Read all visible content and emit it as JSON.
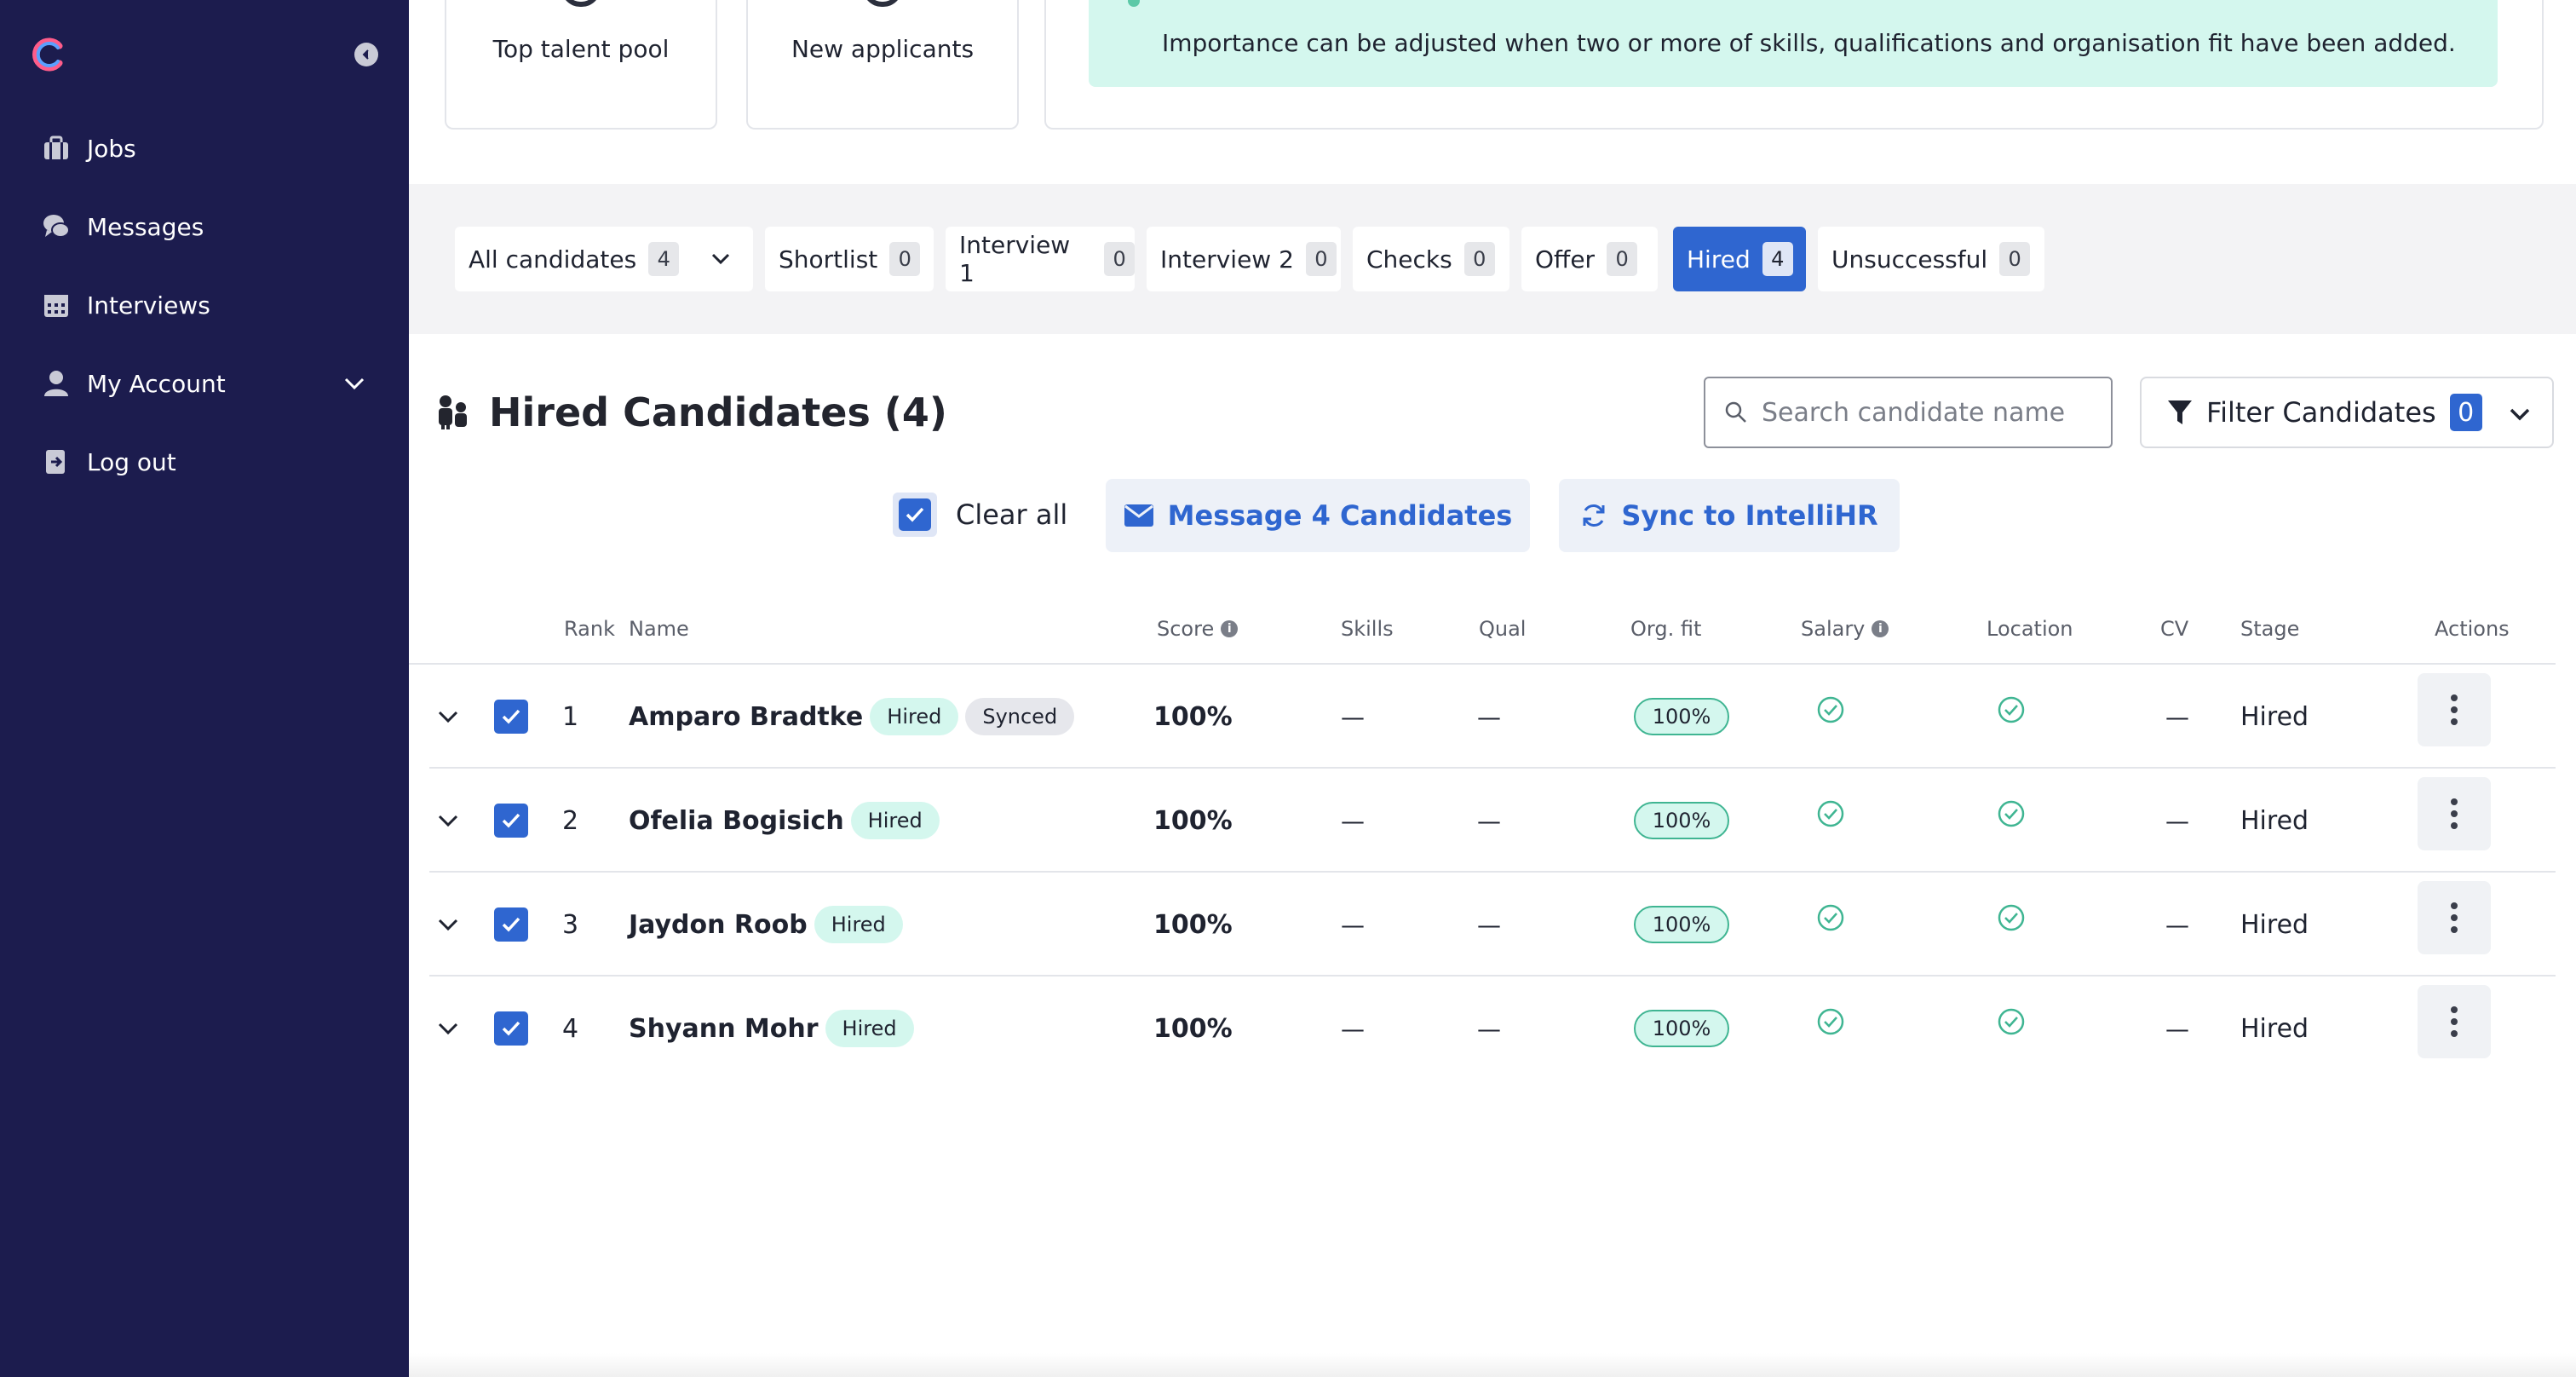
{
  "sidebar": {
    "items": [
      {
        "label": "Jobs",
        "icon": "briefcase-icon"
      },
      {
        "label": "Messages",
        "icon": "chat-bubbles-icon"
      },
      {
        "label": "Interviews",
        "icon": "calendar-icon"
      },
      {
        "label": "My Account",
        "icon": "user-icon"
      },
      {
        "label": "Log out",
        "icon": "logout-icon"
      }
    ]
  },
  "stats": {
    "top_talent": "Top talent pool",
    "new_applicants": "New applicants"
  },
  "info_banner": {
    "text": "Importance can be adjusted when two or more of skills, qualifications and organisation fit have been added."
  },
  "tabs": [
    {
      "label": "All candidates",
      "count": "4"
    },
    {
      "label": "Shortlist",
      "count": "0"
    },
    {
      "label": "Interview 1",
      "count": "0"
    },
    {
      "label": "Interview 2",
      "count": "0"
    },
    {
      "label": "Checks",
      "count": "0"
    },
    {
      "label": "Offer",
      "count": "0"
    },
    {
      "label": "Hired",
      "count": "4"
    },
    {
      "label": "Unsuccessful",
      "count": "0"
    }
  ],
  "section": {
    "title": "Hired Candidates (4)",
    "search_placeholder": "Search candidate name",
    "filter_label": "Filter Candidates",
    "filter_count": "0",
    "clear_all": "Clear all",
    "message_btn": "Message 4 Candidates",
    "sync_btn": "Sync to IntelliHR"
  },
  "table": {
    "headers": {
      "rank": "Rank",
      "name": "Name",
      "score": "Score",
      "skills": "Skills",
      "qual": "Qual",
      "orgfit": "Org. fit",
      "salary": "Salary",
      "location": "Location",
      "cv": "CV",
      "stage": "Stage",
      "actions": "Actions"
    },
    "rows": [
      {
        "rank": "1",
        "name": "Amparo Bradtke",
        "badge1": "Hired",
        "badge2": "Synced",
        "score": "100%",
        "skills": "—",
        "qual": "—",
        "orgfit": "100%",
        "cv": "—",
        "stage": "Hired"
      },
      {
        "rank": "2",
        "name": "Ofelia Bogisich",
        "badge1": "Hired",
        "score": "100%",
        "skills": "—",
        "qual": "—",
        "orgfit": "100%",
        "cv": "—",
        "stage": "Hired"
      },
      {
        "rank": "3",
        "name": "Jaydon Roob",
        "badge1": "Hired",
        "score": "100%",
        "skills": "—",
        "qual": "—",
        "orgfit": "100%",
        "cv": "—",
        "stage": "Hired"
      },
      {
        "rank": "4",
        "name": "Shyann Mohr",
        "badge1": "Hired",
        "score": "100%",
        "skills": "—",
        "qual": "—",
        "orgfit": "100%",
        "cv": "—",
        "stage": "Hired"
      }
    ]
  },
  "colors": {
    "sidebar": "#1c1c4e",
    "accent": "#2f66d0",
    "mint": "#d4f7ee",
    "success": "#3fb592"
  }
}
